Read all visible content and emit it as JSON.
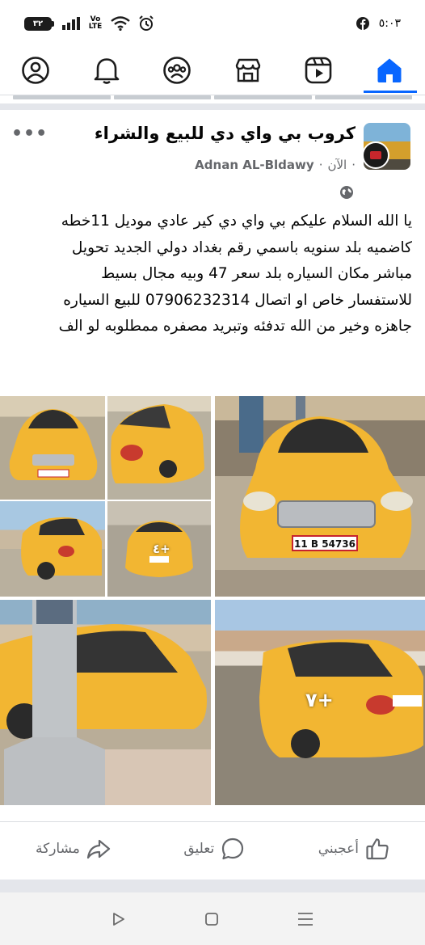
{
  "status_bar": {
    "battery": "٣٢",
    "network": "Vo LTE",
    "time": "٥:٠٣"
  },
  "nav": {
    "items": [
      {
        "name": "profile",
        "icon": "profile-icon",
        "active": false
      },
      {
        "name": "notifications",
        "icon": "bell-icon",
        "active": false
      },
      {
        "name": "groups",
        "icon": "groups-icon",
        "active": false
      },
      {
        "name": "marketplace",
        "icon": "marketplace-icon",
        "active": false
      },
      {
        "name": "video",
        "icon": "video-icon",
        "active": false
      },
      {
        "name": "home",
        "icon": "home-icon",
        "active": true
      }
    ],
    "accent": "#0866ff"
  },
  "post": {
    "group_name": "كروب بي واي دي للبيع والشراء",
    "author": "Adnan AL-Bldawy",
    "time_label": "الآن",
    "more_label": "•••",
    "body_lines": [
      "يا الله السلام عليكم بي واي دي كير عادي موديل 11خطه",
      "كاضميه بلد سنويه باسمي رقم بغداد دولي الجديد تحويل",
      "مباشر مكان السياره بلد سعر 47 وبيه مجال بسيط",
      "للاستفسار خاص او اتصال 07906232314 للبيع  السياره",
      "جاهزه وخير من الله تدفئه وتبريد مصفره ممطلوبه لو الف"
    ],
    "photos": {
      "plate_text": "11 B 54736",
      "overlay_small": "٤+",
      "overlay_large": "٧+"
    }
  },
  "actions": {
    "like": "أعجبني",
    "comment": "تعليق",
    "share": "مشاركة"
  }
}
